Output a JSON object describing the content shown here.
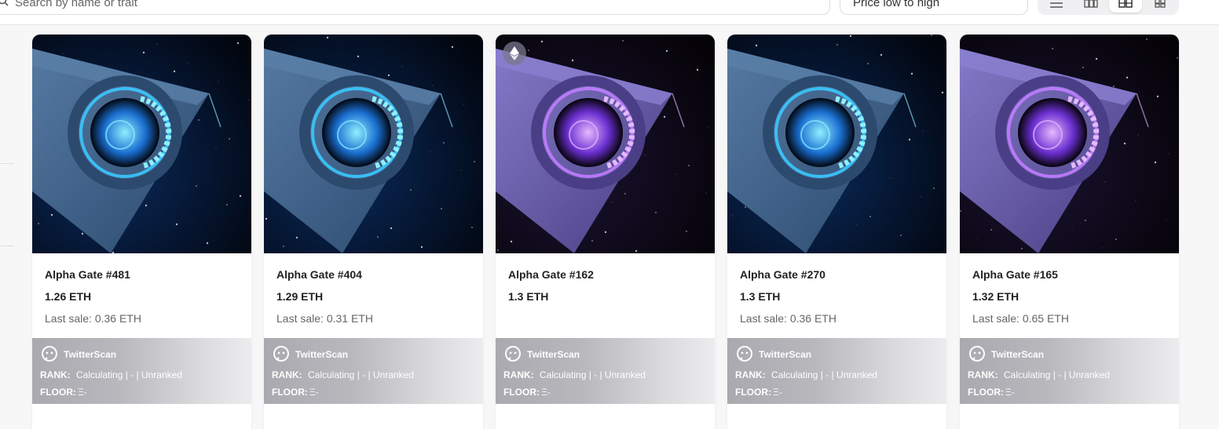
{
  "toolbar": {
    "search_placeholder": "Search by name or trait",
    "sort_value": "Price low to high",
    "view_modes": [
      "list-view-icon",
      "grid-small-icon",
      "grid-large-icon",
      "grid-icon"
    ]
  },
  "colors": {
    "card_bg": "#ffffff",
    "page_bg": "#f7f7f8",
    "twitterscan_gradient_start": "#a9a9af"
  },
  "cards": [
    {
      "name": "Alpha Gate #481",
      "price": "1.26 ETH",
      "last_sale": "Last sale: 0.36 ETH",
      "theme": "blue",
      "eth_badge": false,
      "twitterscan": {
        "brand": "TwitterScan",
        "rank_label": "RANK:",
        "rank_value": "Calculating | - | Unranked",
        "floor_label": "FLOOR:",
        "floor_value": "Ξ-"
      }
    },
    {
      "name": "Alpha Gate #404",
      "price": "1.29 ETH",
      "last_sale": "Last sale: 0.31 ETH",
      "theme": "blue",
      "eth_badge": false,
      "twitterscan": {
        "brand": "TwitterScan",
        "rank_label": "RANK:",
        "rank_value": "Calculating | - | Unranked",
        "floor_label": "FLOOR:",
        "floor_value": "Ξ-"
      }
    },
    {
      "name": "Alpha Gate #162",
      "price": "1.3 ETH",
      "last_sale": "",
      "theme": "purple",
      "eth_badge": true,
      "twitterscan": {
        "brand": "TwitterScan",
        "rank_label": "RANK:",
        "rank_value": "Calculating | - | Unranked",
        "floor_label": "FLOOR:",
        "floor_value": "Ξ-"
      }
    },
    {
      "name": "Alpha Gate #270",
      "price": "1.3 ETH",
      "last_sale": "Last sale: 0.36 ETH",
      "theme": "blue",
      "eth_badge": false,
      "twitterscan": {
        "brand": "TwitterScan",
        "rank_label": "RANK:",
        "rank_value": "Calculating | - | Unranked",
        "floor_label": "FLOOR:",
        "floor_value": "Ξ-"
      }
    },
    {
      "name": "Alpha Gate #165",
      "price": "1.32 ETH",
      "last_sale": "Last sale: 0.65 ETH",
      "theme": "purple",
      "eth_badge": false,
      "twitterscan": {
        "brand": "TwitterScan",
        "rank_label": "RANK:",
        "rank_value": "Calculating | - | Unranked",
        "floor_label": "FLOOR:",
        "floor_value": "Ξ-"
      }
    }
  ]
}
